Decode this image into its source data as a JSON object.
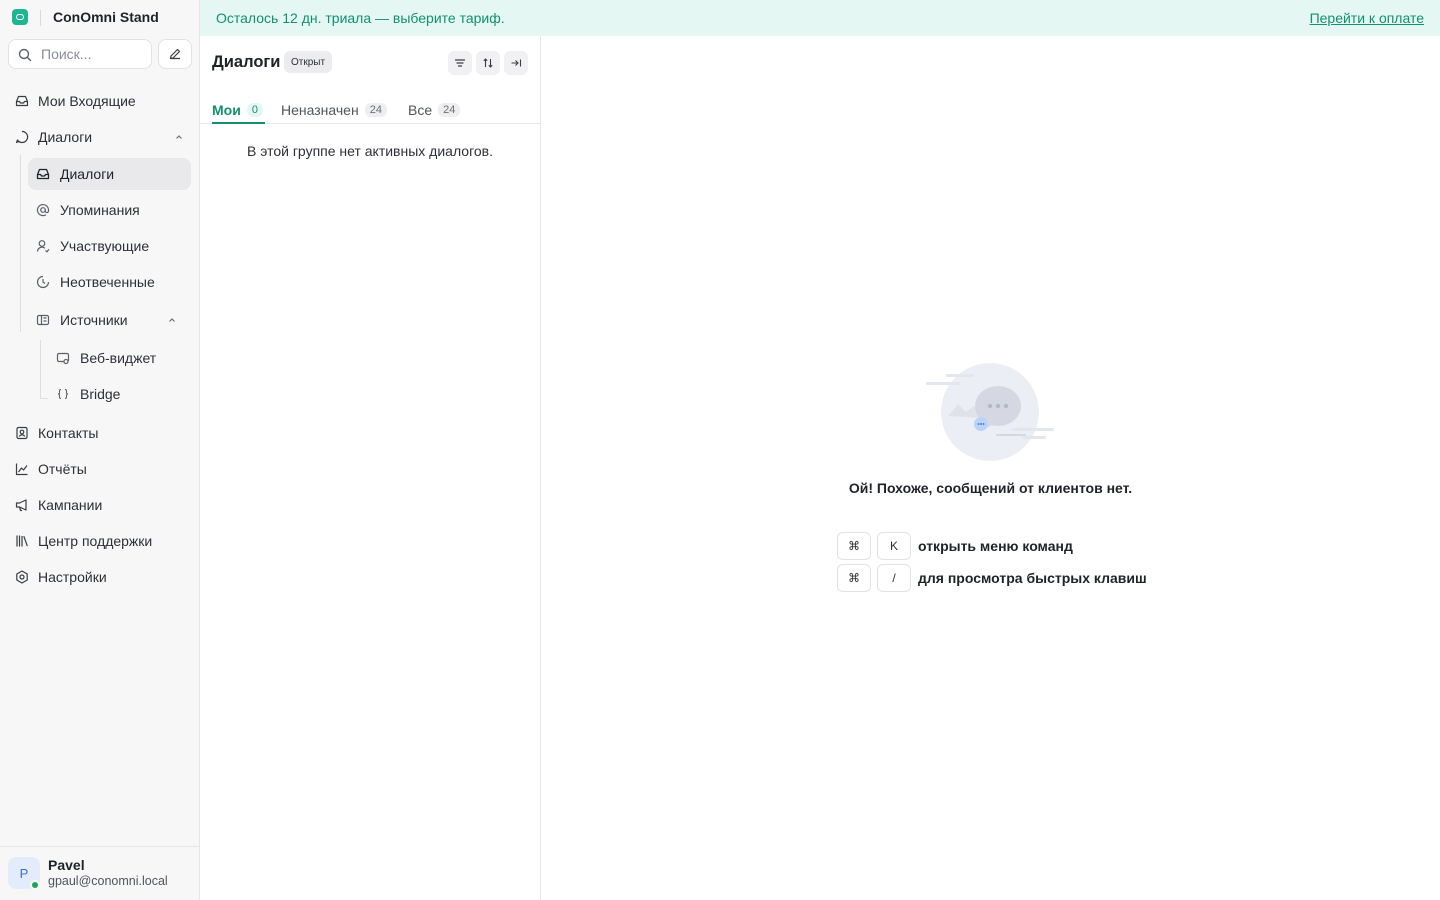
{
  "brand": {
    "name": "ConOmni Stand",
    "accent": "#1fb591"
  },
  "search": {
    "placeholder": "Поиск..."
  },
  "nav": {
    "my_inbox": "Мои Входящие",
    "conversations": "Диалоги",
    "conversations_sub": {
      "conversations": "Диалоги",
      "mentions": "Упоминания",
      "participating": "Участвующие",
      "unattended": "Неотвеченные",
      "sources": "Источники",
      "sources_sub": {
        "web_widget": "Веб-виджет",
        "bridge": "Bridge"
      }
    },
    "contacts": "Контакты",
    "reports": "Отчёты",
    "campaigns": "Кампании",
    "help_center": "Центр поддержки",
    "settings": "Настройки"
  },
  "user": {
    "initial": "P",
    "name": "Pavel",
    "email": "gpaul@conomni.local",
    "status_color": "#1fa35b"
  },
  "banner": {
    "text": "Осталось 12 дн. триала — выберите тариф.",
    "link": "Перейти к оплате",
    "color": "#13906f",
    "background": "#e4f7f2"
  },
  "list": {
    "title": "Диалоги",
    "status": "Открыт",
    "tabs": [
      {
        "label": "Мои",
        "count": "0",
        "active": true
      },
      {
        "label": "Неназначен",
        "count": "24",
        "active": false
      },
      {
        "label": "Все",
        "count": "24",
        "active": false
      }
    ],
    "empty": "В этой группе нет активных диалогов."
  },
  "main": {
    "empty_message": "Ой! Похоже, сообщений от клиентов нет.",
    "shortcuts": [
      {
        "keys": [
          "⌘",
          "K"
        ],
        "description": "открыть меню команд"
      },
      {
        "keys": [
          "⌘",
          "/"
        ],
        "description": "для просмотра быстрых клавиш"
      }
    ]
  }
}
